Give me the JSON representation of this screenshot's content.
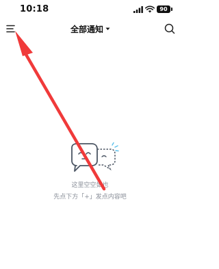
{
  "status_bar": {
    "time": "10:18",
    "battery": "90"
  },
  "header": {
    "title": "全部通知",
    "menu_icon": "menu-icon",
    "dropdown_icon": "chevron-down-icon",
    "search_icon": "search-icon"
  },
  "empty_state": {
    "title": "这里空空如也",
    "hint": "先点下方「+」发点内容吧",
    "illustration": "empty-chat-illustration"
  },
  "colors": {
    "background": "#ffffff",
    "text": "#111111",
    "secondary_text": "#8a8f99",
    "illustration_stroke": "#4b5563",
    "illustration_accent": "#5bc0eb",
    "annotation_arrow": "#f03a3a"
  }
}
